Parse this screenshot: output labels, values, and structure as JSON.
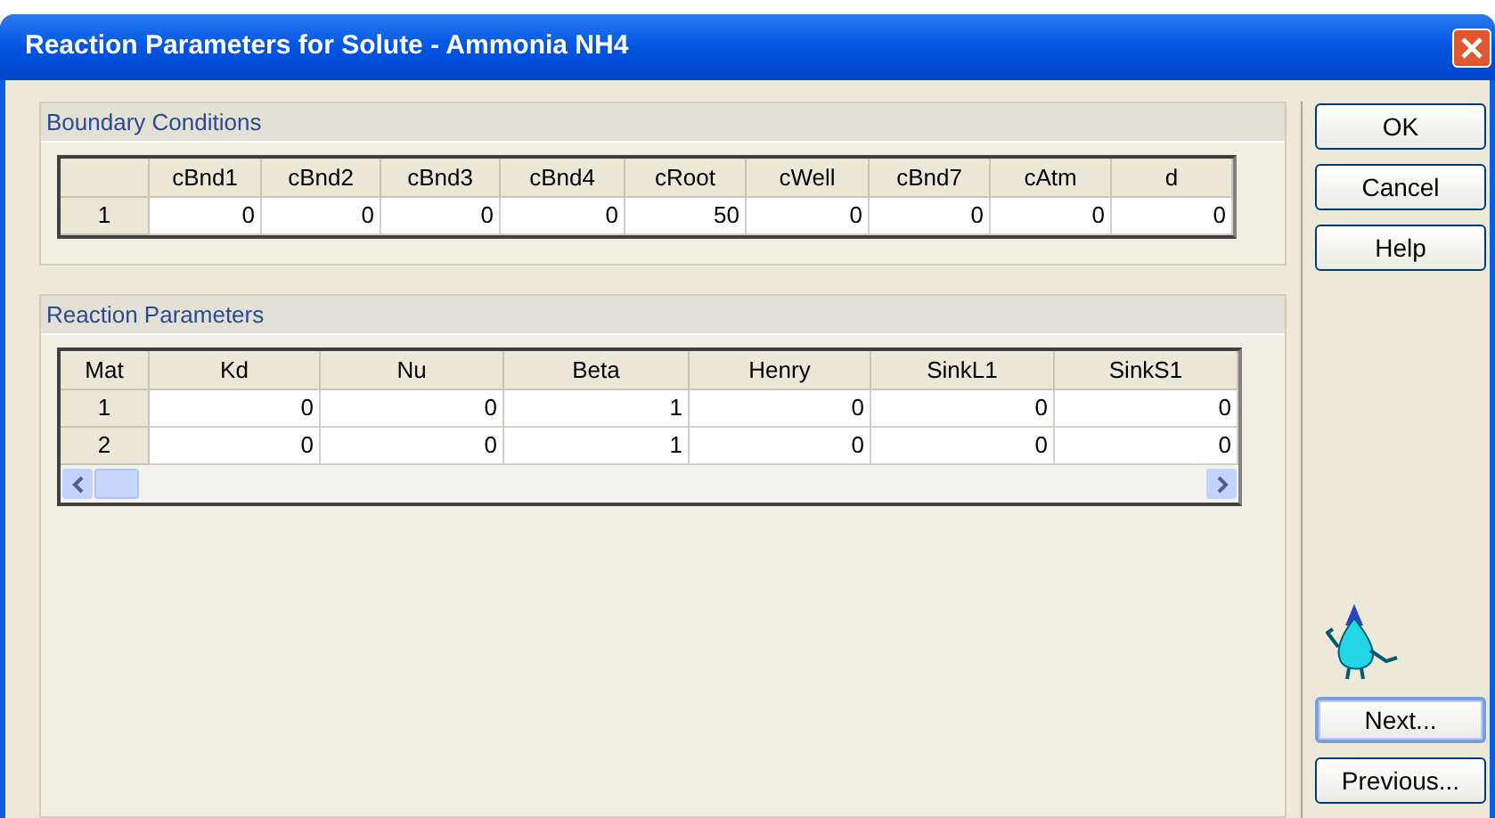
{
  "window": {
    "title": "Reaction Parameters for Solute - Ammonia NH4"
  },
  "boundary_conditions": {
    "title": "Boundary Conditions",
    "columns": [
      "cBnd1",
      "cBnd2",
      "cBnd3",
      "cBnd4",
      "cRoot",
      "cWell",
      "cBnd7",
      "cAtm",
      "d"
    ],
    "rows": [
      {
        "header": "1",
        "cells": [
          "0",
          "0",
          "0",
          "0",
          "50",
          "0",
          "0",
          "0",
          "0"
        ]
      }
    ]
  },
  "reaction_parameters": {
    "title": "Reaction Parameters",
    "corner": "Mat",
    "columns": [
      "Kd",
      "Nu",
      "Beta",
      "Henry",
      "SinkL1",
      "SinkS1"
    ],
    "rows": [
      {
        "header": "1",
        "cells": [
          "0",
          "0",
          "1",
          "0",
          "0",
          "0"
        ]
      },
      {
        "header": "2",
        "cells": [
          "0",
          "0",
          "1",
          "0",
          "0",
          "0"
        ]
      }
    ]
  },
  "buttons_top": [
    {
      "label": "OK",
      "focused": false
    },
    {
      "label": "Cancel",
      "focused": false
    },
    {
      "label": "Help",
      "focused": false
    }
  ],
  "buttons_bottom": [
    {
      "label": "Next...",
      "focused": true
    },
    {
      "label": "Previous...",
      "focused": false
    }
  ]
}
